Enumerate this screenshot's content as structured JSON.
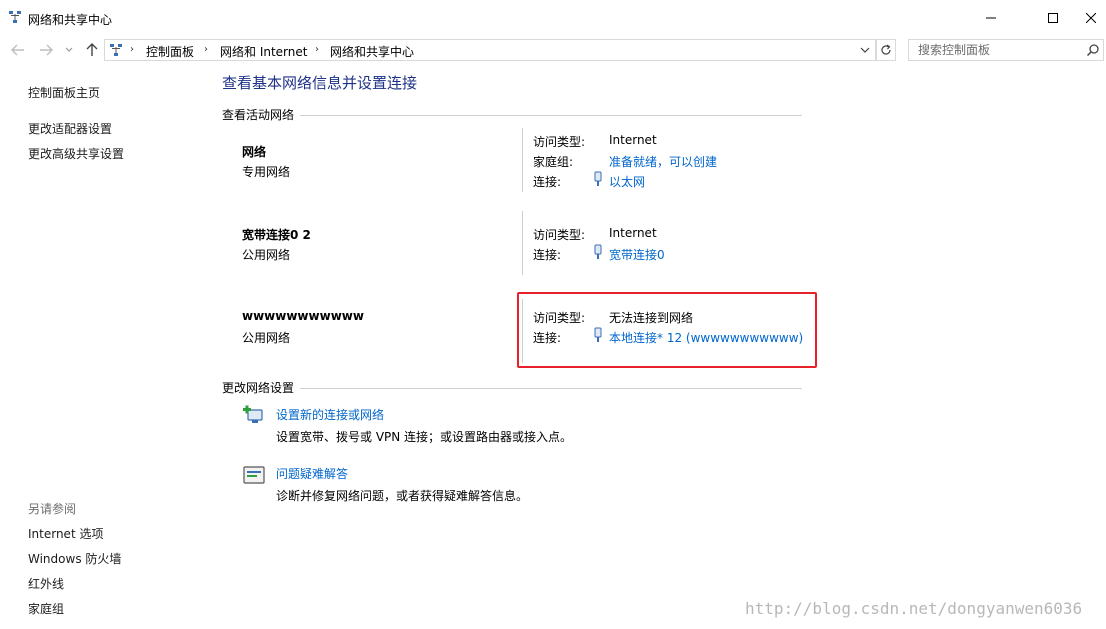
{
  "window": {
    "title": "网络和共享中心",
    "icon": "network-center-icon",
    "controls": {
      "minimize": "minimize-icon",
      "maximize": "maximize-icon",
      "close": "close-icon"
    }
  },
  "addressbar": {
    "breadcrumb": [
      "控制面板",
      "网络和 Internet",
      "网络和共享中心"
    ],
    "separator": "›",
    "search_placeholder": "搜索控制面板"
  },
  "sidebar": {
    "links": [
      "控制面板主页",
      "更改适配器设置",
      "更改高级共享设置"
    ],
    "see_also_title": "另请参阅",
    "see_also": [
      "Internet 选项",
      "Windows 防火墙",
      "红外线",
      "家庭组"
    ]
  },
  "main": {
    "title": "查看基本网络信息并设置连接",
    "active_networks_heading": "查看活动网络",
    "networks": [
      {
        "name": "网络",
        "type": "专用网络",
        "props": [
          {
            "label": "访问类型:",
            "value": "Internet",
            "link": false
          },
          {
            "label": "家庭组:",
            "value": "准备就绪，可以创建",
            "link": true
          },
          {
            "label": "连接:",
            "value": "以太网",
            "link": true,
            "icon": "ethernet-icon"
          }
        ]
      },
      {
        "name": "宽带连接0  2",
        "type": "公用网络",
        "props": [
          {
            "label": "访问类型:",
            "value": "Internet",
            "link": false
          },
          {
            "label": "连接:",
            "value": "宽带连接0",
            "link": true,
            "icon": "ethernet-icon"
          }
        ]
      },
      {
        "name": "wwwwwwwwwww",
        "type": "公用网络",
        "props": [
          {
            "label": "访问类型:",
            "value": "无法连接到网络",
            "link": false
          },
          {
            "label": "连接:",
            "value": "本地连接* 12 (wwwwwwwwwww)",
            "link": true,
            "icon": "ethernet-icon"
          }
        ]
      }
    ],
    "change_settings_heading": "更改网络设置",
    "tasks": [
      {
        "link": "设置新的连接或网络",
        "desc": "设置宽带、拨号或 VPN 连接；或设置路由器或接入点。",
        "icon": "new-connection-icon"
      },
      {
        "link": "问题疑难解答",
        "desc": "诊断并修复网络问题，或者获得疑难解答信息。",
        "icon": "troubleshoot-icon"
      }
    ]
  },
  "watermark": "http://blog.csdn.net/dongyanwen6036",
  "colors": {
    "link": "#0066cc",
    "title": "#1e3287",
    "highlight": "#e8202a",
    "rule": "#cfcfcf"
  }
}
